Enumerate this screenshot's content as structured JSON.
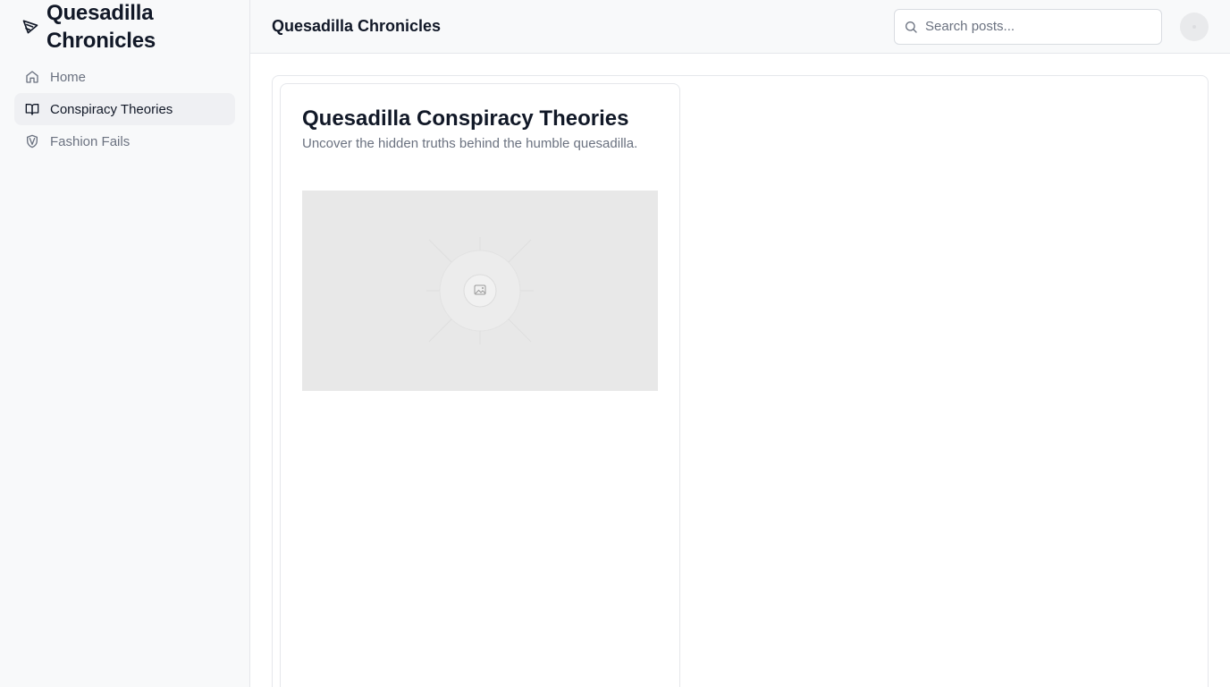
{
  "sidebar": {
    "brand": {
      "title": "Quesadilla Chronicles",
      "icon": "pizza-slice-icon"
    },
    "items": [
      {
        "label": "Home",
        "icon": "home-icon",
        "active": false
      },
      {
        "label": "Conspiracy Theories",
        "icon": "open-book-icon",
        "active": true
      },
      {
        "label": "Fashion Fails",
        "icon": "shield-icon",
        "active": false
      }
    ]
  },
  "header": {
    "title": "Quesadilla Chronicles",
    "search": {
      "placeholder": "Search posts...",
      "value": ""
    }
  },
  "main": {
    "card": {
      "title": "Quesadilla Conspiracy Theories",
      "subtitle": "Uncover the hidden truths behind the humble quesadilla.",
      "image": {
        "icon": "image-placeholder-icon"
      }
    }
  },
  "colors": {
    "sidebar_bg": "#f8f9fa",
    "active_item_bg": "#eff0f3",
    "text_primary": "#111827",
    "text_muted": "#6b7280",
    "border": "#e5e7eb",
    "image_placeholder_bg": "#e8e8e8"
  }
}
